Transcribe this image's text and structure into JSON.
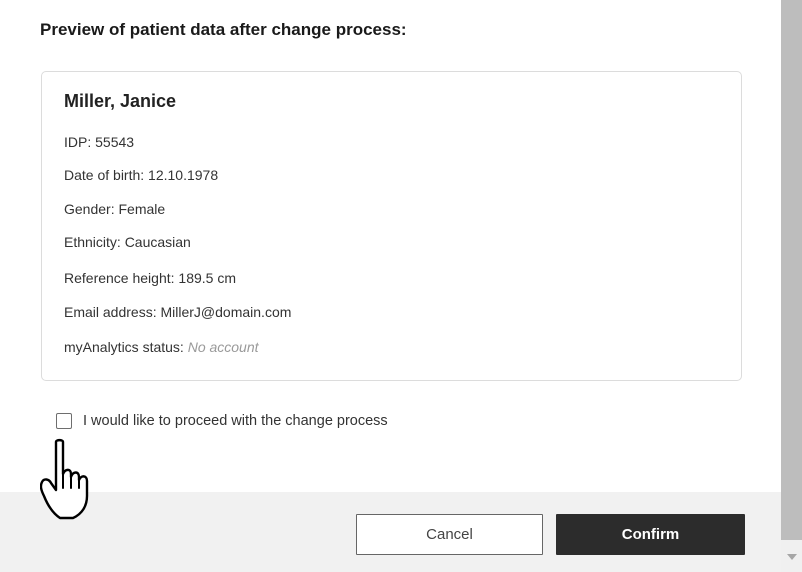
{
  "dialog": {
    "heading": "Preview of patient data after change process:"
  },
  "patient": {
    "name": "Miller, Janice",
    "idp": "IDP: 55543",
    "date_of_birth": "Date of birth: 12.10.1978",
    "gender": "Gender: Female",
    "ethnicity": "Ethnicity: Caucasian",
    "reference_height": "Reference height: 189.5 cm",
    "email": "Email address: MillerJ@domain.com",
    "myanalytics_label": "myAnalytics status: ",
    "myanalytics_value": "No account"
  },
  "consent": {
    "checked": false,
    "label": "I would like to proceed with the change process"
  },
  "buttons": {
    "cancel": "Cancel",
    "confirm": "Confirm"
  },
  "cursor": {
    "icon": "hand-pointer-icon"
  }
}
